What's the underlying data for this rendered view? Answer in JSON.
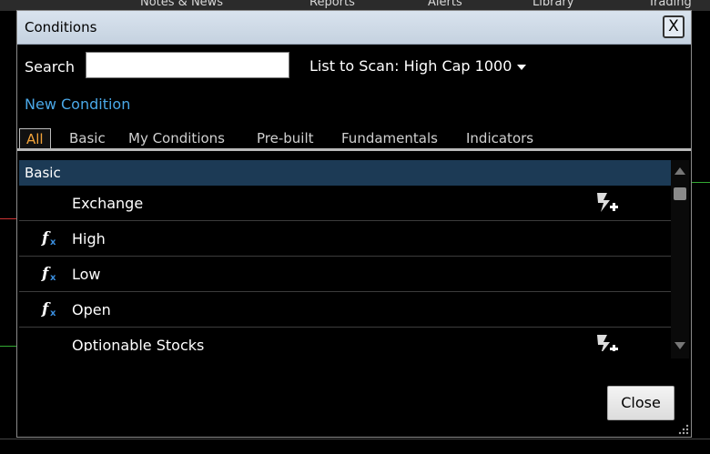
{
  "background": {
    "menu_items": [
      "Notes & News",
      "Reports",
      "Alerts",
      "Library",
      "Trading"
    ]
  },
  "dialog": {
    "title": "Conditions",
    "close_x_label": "X",
    "search_label": "Search",
    "search_value": "",
    "list_to_scan": "List to Scan: High Cap 1000",
    "new_condition": "New Condition",
    "tabs": [
      "All",
      "Basic",
      "My Conditions",
      "Pre-built",
      "Fundamentals",
      "Indicators"
    ],
    "active_tab": "All",
    "group_header": "Basic",
    "rows": [
      {
        "label": "Exchange",
        "fx_icon": false,
        "action_icon": "add-condition-icon"
      },
      {
        "label": "High",
        "fx_icon": true,
        "action_icon": ""
      },
      {
        "label": "Low",
        "fx_icon": true,
        "action_icon": ""
      },
      {
        "label": "Open",
        "fx_icon": true,
        "action_icon": ""
      },
      {
        "label": "Optionable Stocks",
        "fx_icon": false,
        "action_icon": "add-condition-icon"
      }
    ],
    "close_button": "Close"
  },
  "colors": {
    "accent_link": "#4aa8e8",
    "active_tab": "#f2a33a",
    "group_header_bg": "#1c3a55"
  }
}
